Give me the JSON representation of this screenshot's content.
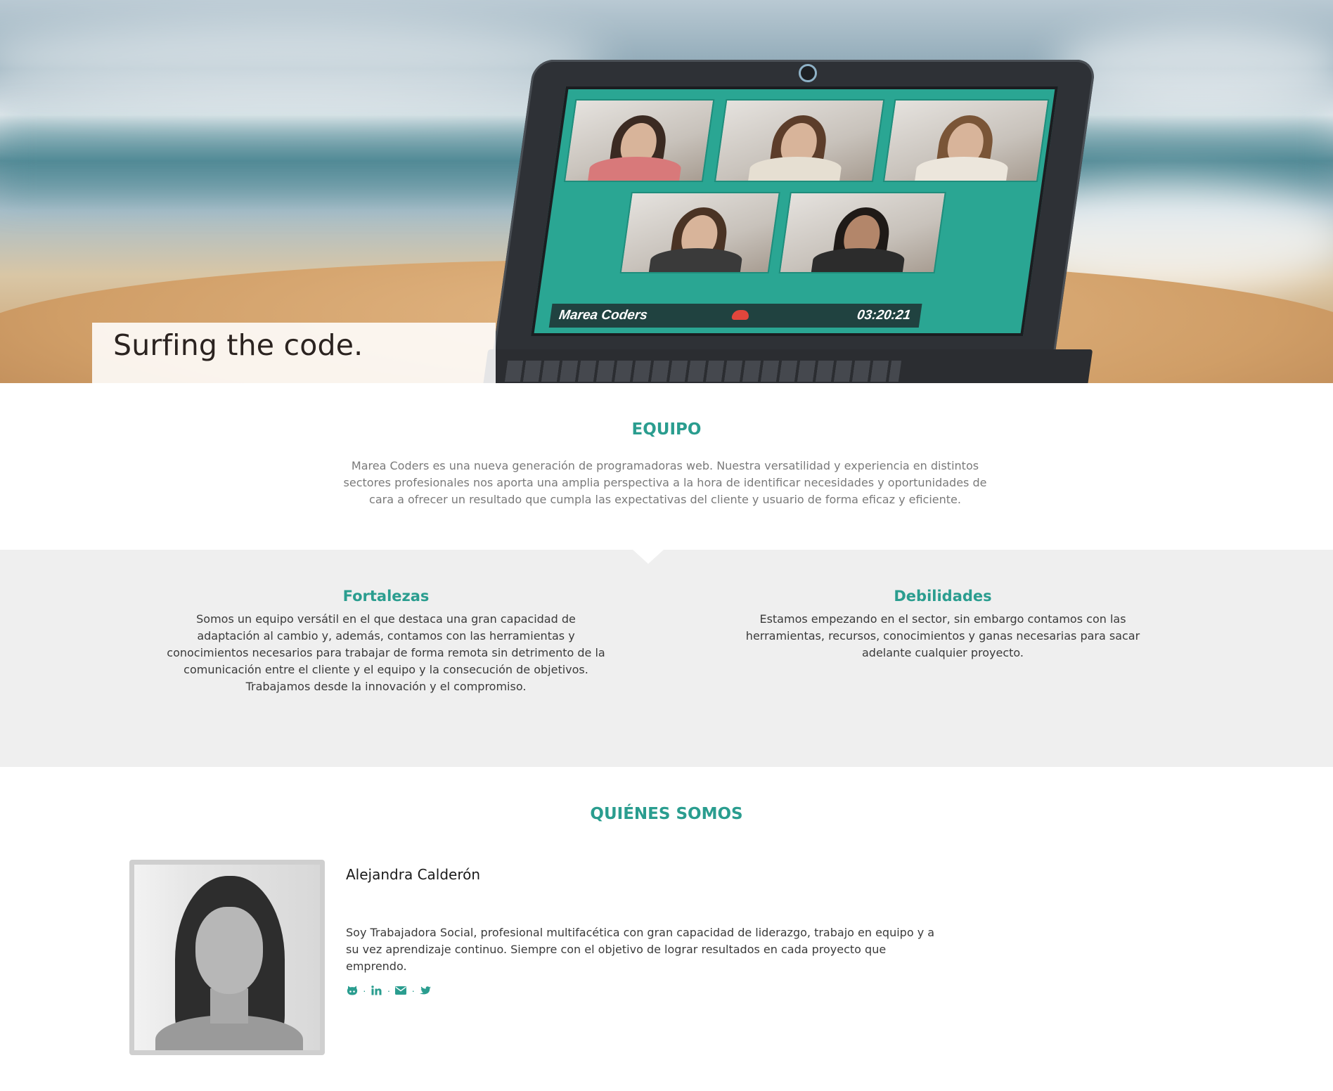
{
  "hero": {
    "tagline": "Surfing the code.",
    "screen": {
      "call_name": "Marea Coders",
      "call_time": "03:20:21"
    }
  },
  "equipo": {
    "title": "EQUIPO",
    "description": "Marea Coders es una nueva generación de programadoras web. Nuestra versatilidad y experiencia en distintos sectores profesionales nos aporta una amplia perspectiva a la hora de identificar necesidades y oportunidades de cara a ofrecer un resultado que cumpla las expectativas del cliente y usuario de forma eficaz y eficiente."
  },
  "features": {
    "strengths": {
      "title": "Fortalezas",
      "text": "Somos un equipo versátil en el que destaca una gran capacidad de adaptación al cambio y, además, contamos con las herramientas y conocimientos necesarios para trabajar de forma remota sin detrimento de la comunicación entre el cliente y el equipo y la consecución de objetivos. Trabajamos desde la innovación y el compromiso."
    },
    "weaknesses": {
      "title": "Debilidades",
      "text": "Estamos empezando en el sector, sin embargo contamos con las herramientas, recursos, conocimientos y ganas necesarias para sacar adelante cualquier proyecto."
    }
  },
  "quienes": {
    "title": "QUIÉNES SOMOS",
    "member": {
      "name": "Alejandra Calderón",
      "bio": "Soy Trabajadora Social, profesional multifacética con gran capacidad de liderazgo, trabajo en equipo y a su vez aprendizaje continuo. Siempre con el objetivo de lograr resultados en cada proyecto que emprendo.",
      "social": [
        {
          "icon": "github-icon",
          "separator": "·"
        },
        {
          "icon": "linkedin-icon",
          "separator": "·"
        },
        {
          "icon": "email-icon",
          "separator": "·"
        },
        {
          "icon": "twitter-icon"
        }
      ]
    }
  },
  "colors": {
    "accent": "#2a9d8f",
    "band_background": "#efefef",
    "muted_text": "#7a7a7a"
  }
}
